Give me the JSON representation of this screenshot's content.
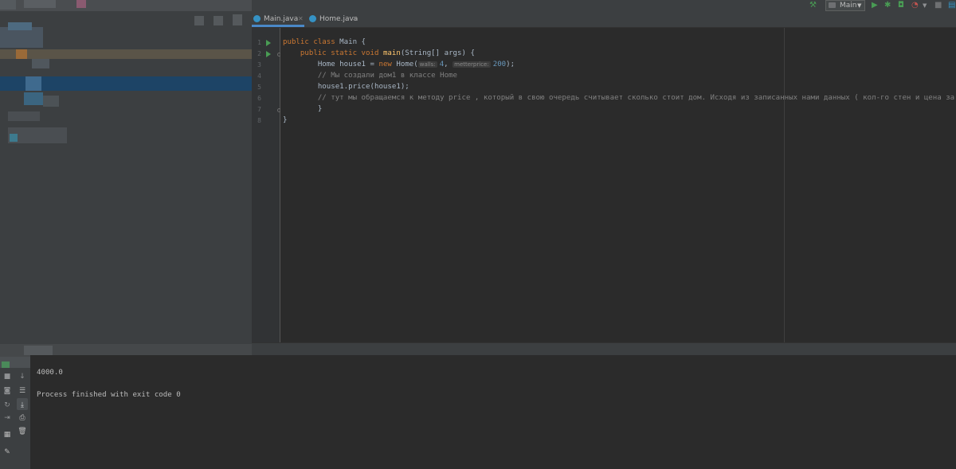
{
  "toolbar": {
    "run_config": "Main",
    "icons": [
      "hammer-icon",
      "run-config-icon",
      "run-icon",
      "debug-icon",
      "coverage-icon",
      "profile-icon",
      "stop-icon",
      "project-structure-icon"
    ]
  },
  "tabs": [
    {
      "label": "Main.java",
      "active": true
    },
    {
      "label": "Home.java",
      "active": false
    }
  ],
  "gutter": {
    "line_numbers": [
      "1",
      "2",
      "3",
      "4",
      "5",
      "6",
      "7",
      "8"
    ]
  },
  "code": {
    "line1_kw": "public class",
    "line1_rest": " Main {",
    "line2_kw": "public static void",
    "line2_fn": "main",
    "line2_rest": "(String[] args) {",
    "line3_a": "Home house1 = ",
    "line3_kw": "new",
    "line3_b": " Home(",
    "line3_hint1": "walls:",
    "line3_num1": "4",
    "line3_comma": ", ",
    "line3_hint2": "metterprice:",
    "line3_num2": "200",
    "line3_end": ");",
    "line4": "// Мы создали дом1 в классе Home",
    "line5": "house1.price(house1);",
    "line6": "// тут мы обращаемся к методу price , который в свою очередь считывает сколько стоит дом. Исходя из записанных нами данных ( кол-го стен и цена за метр )",
    "line7": "}",
    "line8": "}"
  },
  "console": {
    "output": "4000.0",
    "exit_message": "Process finished with exit code 0"
  },
  "colors": {
    "editor_bg": "#2b2b2b",
    "panel_bg": "#3c3f41",
    "keyword": "#cc7832",
    "function": "#ffc66d",
    "number": "#6897bb",
    "comment": "#808080",
    "run_green": "#499c54"
  }
}
